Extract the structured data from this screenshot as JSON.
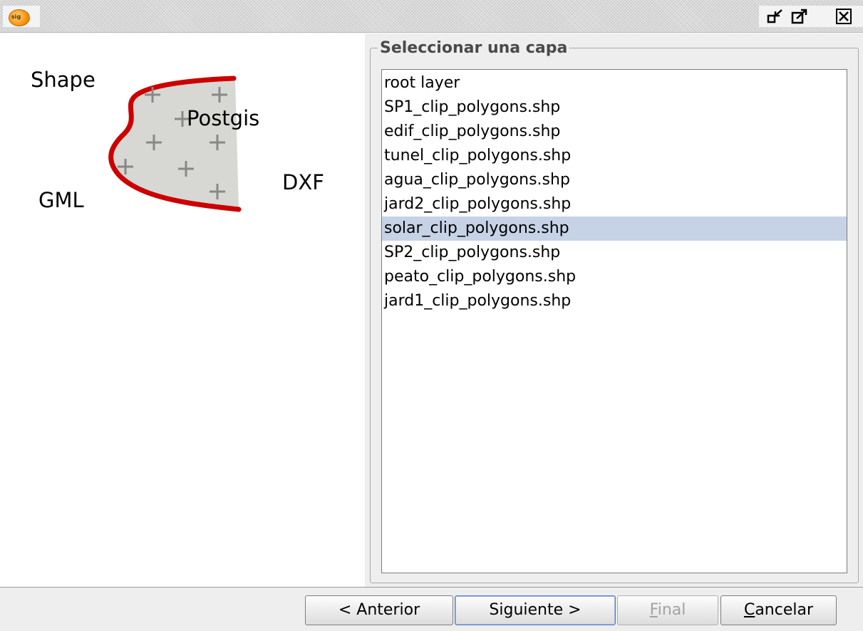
{
  "window": {
    "app_icon": "gvsig-logo-icon",
    "controls": [
      "minimize-icon",
      "maximize-icon",
      "close-icon"
    ]
  },
  "illustration": {
    "labels": {
      "shape": "Shape",
      "postgis": "Postgis",
      "dxf": "DXF",
      "gml": "GML"
    },
    "colors": {
      "outline": "#cc0000",
      "fill": "#d7d8d3",
      "cross": "#888888"
    }
  },
  "layer_selector": {
    "title": "Seleccionar una capa",
    "items": [
      "root layer",
      "SP1_clip_polygons.shp",
      "edif_clip_polygons.shp",
      "tunel_clip_polygons.shp",
      "agua_clip_polygons.shp",
      "jard2_clip_polygons.shp",
      "solar_clip_polygons.shp",
      "SP2_clip_polygons.shp",
      "peato_clip_polygons.shp",
      "jard1_clip_polygons.shp"
    ],
    "selected_index": 6,
    "selected_color": "#c6d3e6"
  },
  "buttons": {
    "previous": "< Anterior",
    "next": "Siguiente >",
    "finish_first": "F",
    "finish_rest": "inal",
    "cancel_first": "C",
    "cancel_rest": "ancelar"
  }
}
